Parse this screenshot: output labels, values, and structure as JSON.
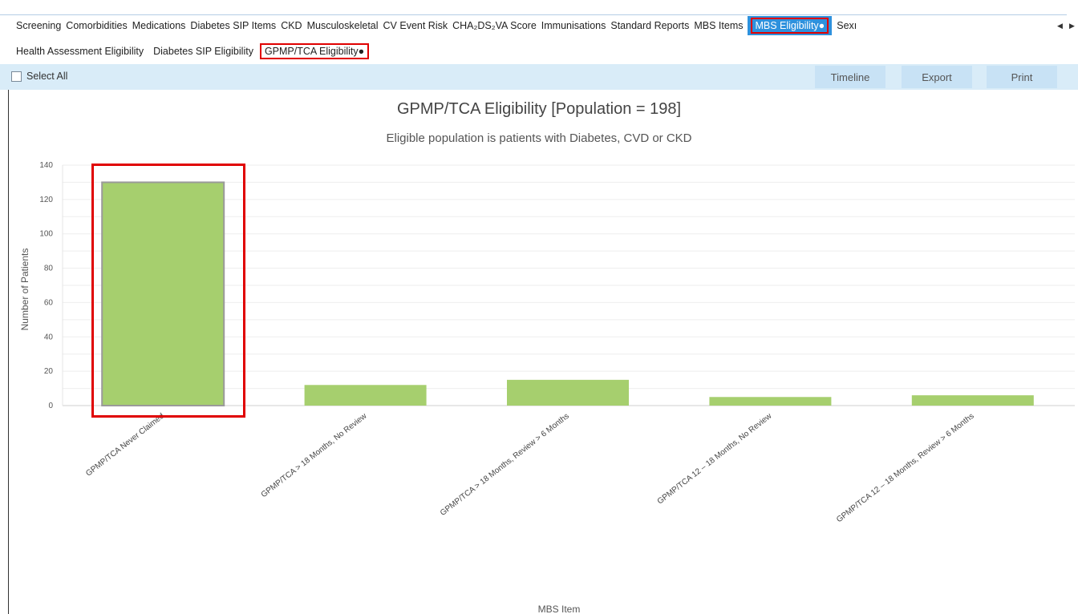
{
  "main_tabs": [
    "Screening",
    "Comorbidities",
    "Medications",
    "Diabetes SIP Items",
    "CKD",
    "Musculoskeletal",
    "CV Event Risk",
    "CHA₂DS₂VA Score",
    "Immunisations",
    "Standard Reports",
    "MBS Items"
  ],
  "active_main_tab": "MBS Eligibility●",
  "truncated_tab": "Sexı",
  "scroll_left": "◀",
  "scroll_right": "▶",
  "sub_tabs": [
    "Health Assessment Eligibility",
    "Diabetes SIP Eligibility"
  ],
  "active_sub_tab": "GPMP/TCA Eligibility●",
  "toolbar": {
    "select_all": "Select All",
    "timeline": "Timeline",
    "export": "Export",
    "print": "Print"
  },
  "chart_data": {
    "type": "bar",
    "title": "GPMP/TCA Eligibility [Population = 198]",
    "subtitle": "Eligible population is patients with Diabetes, CVD or CKD",
    "xlabel": "MBS Item",
    "ylabel": "Number of Patients",
    "ylim": [
      0,
      140
    ],
    "yticks": [
      0,
      20,
      40,
      60,
      80,
      100,
      120,
      140
    ],
    "categories": [
      "GPMP/TCA Never Claimed",
      "GPMP/TCA > 18 Months, No Review",
      "GPMP/TCA > 18 Months, Review > 6 Months",
      "GPMP/TCA 12 – 18 Months, No Review",
      "GPMP/TCA 12 – 18 Months, Review > 6 Months"
    ],
    "values": [
      130,
      12,
      15,
      5,
      6
    ],
    "bar_color": "#a6cf6e",
    "highlighted_category": "GPMP/TCA Never Claimed",
    "grid": true
  }
}
